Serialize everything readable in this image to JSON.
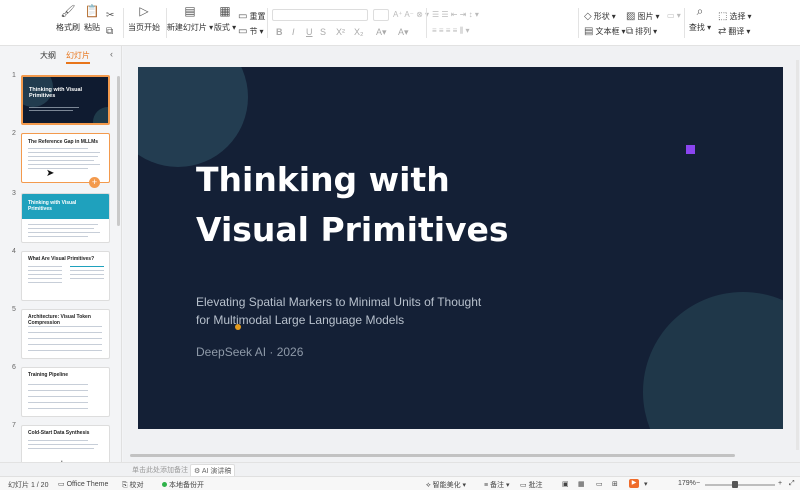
{
  "ribbon": {
    "format_painter": "格式刷",
    "paste": "粘贴",
    "start_from_current": "当页开始",
    "new_slide": "新建幻灯片",
    "layout": "版式",
    "section": "节",
    "reset": "重置",
    "shape": "形状",
    "textbox": "文本框",
    "picture": "图片",
    "arrange": "排列",
    "find": "查找",
    "select": "选择",
    "translate": "翻译"
  },
  "panel": {
    "tab_outline": "大纲",
    "tab_slides": "幻灯片",
    "thumbnails": [
      {
        "num": "1",
        "title": "Thinking with Visual Primitives"
      },
      {
        "num": "2",
        "title": "The Reference Gap in MLLMs"
      },
      {
        "num": "3",
        "title": "Thinking with Visual Primitives"
      },
      {
        "num": "4",
        "title": "What Are Visual Primitives?"
      },
      {
        "num": "5",
        "title": "Architecture: Visual Token Compression"
      },
      {
        "num": "6",
        "title": "Training Pipeline"
      },
      {
        "num": "7",
        "title": "Cold-Start Data Synthesis"
      }
    ]
  },
  "slide": {
    "title_line1": "Thinking with",
    "title_line2": "Visual Primitives",
    "subtitle_line1": "Elevating Spatial Markers to Minimal Units of Thought",
    "subtitle_line2": "for Multimodal Large Language Models",
    "author": "DeepSeek AI  ·  2026",
    "colors": {
      "background": "#142036",
      "accent_purple": "#8b45f0",
      "accent_orange": "#e39a1d",
      "teal_circle": "#3a6a78"
    }
  },
  "notes": {
    "placeholder": "单击此处添加备注",
    "ai_notes": "AI 演讲稿"
  },
  "status": {
    "slide_count": "幻灯片 1 / 20",
    "theme": "Office Theme",
    "proofread": "校对",
    "backup": "本地备份开",
    "beautify": "智能美化",
    "notes_btn": "备注",
    "comments_btn": "批注",
    "zoom": "179%"
  }
}
